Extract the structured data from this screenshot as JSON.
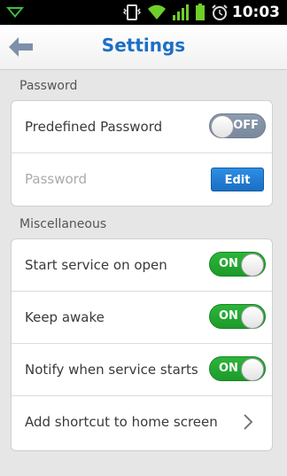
{
  "status_bar": {
    "time": "10:03",
    "icons": [
      "notification-icon",
      "vibrate-icon",
      "wifi-icon",
      "signal-icon",
      "battery-icon",
      "alarm-icon"
    ]
  },
  "app_bar": {
    "title": "Settings",
    "back_icon": "back-arrow-icon"
  },
  "sections": [
    {
      "label": "Password",
      "rows": [
        {
          "label": "Predefined Password",
          "control": "toggle",
          "state": "OFF"
        },
        {
          "label": "Password",
          "control": "button",
          "button_label": "Edit"
        }
      ]
    },
    {
      "label": "Miscellaneous",
      "rows": [
        {
          "label": "Start service on open",
          "control": "toggle",
          "state": "ON"
        },
        {
          "label": "Keep awake",
          "control": "toggle",
          "state": "ON"
        },
        {
          "label": "Notify when service starts",
          "control": "toggle",
          "state": "ON"
        },
        {
          "label": "Add shortcut to home screen",
          "control": "chevron",
          "icon": "chevron-right-icon"
        }
      ]
    }
  ],
  "colors": {
    "accent": "#1d6fc5",
    "toggle_on": "#22a832",
    "toggle_off": "#8492a6",
    "button": "#1f7bd3"
  }
}
